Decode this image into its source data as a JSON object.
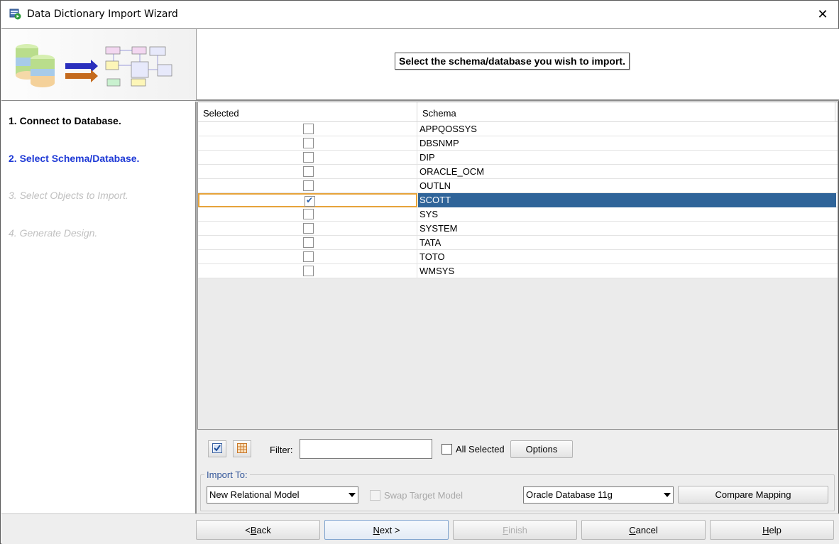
{
  "window": {
    "title": "Data Dictionary Import Wizard",
    "close_glyph": "✕"
  },
  "banner": {
    "title": "Select the schema/database you wish to import."
  },
  "steps": [
    {
      "label": "1. Connect to Database.",
      "state": "done"
    },
    {
      "label": "2. Select Schema/Database.",
      "state": "current"
    },
    {
      "label": "3. Select Objects to Import.",
      "state": "pending"
    },
    {
      "label": "4. Generate Design.",
      "state": "pending"
    }
  ],
  "grid": {
    "columns": [
      "Selected",
      "Schema"
    ],
    "rows": [
      {
        "schema": "APPQOSSYS",
        "selected": false
      },
      {
        "schema": "DBSNMP",
        "selected": false
      },
      {
        "schema": "DIP",
        "selected": false
      },
      {
        "schema": "ORACLE_OCM",
        "selected": false
      },
      {
        "schema": "OUTLN",
        "selected": false
      },
      {
        "schema": "SCOTT",
        "selected": true
      },
      {
        "schema": "SYS",
        "selected": false
      },
      {
        "schema": "SYSTEM",
        "selected": false
      },
      {
        "schema": "TATA",
        "selected": false
      },
      {
        "schema": "TOTO",
        "selected": false
      },
      {
        "schema": "WMSYS",
        "selected": false
      }
    ],
    "highlighted_row": "SCOTT"
  },
  "filter": {
    "label": "Filter:",
    "value": "",
    "all_selected_label": "All Selected",
    "all_selected": false,
    "options_label": "Options",
    "select_all_icon": "check-all-icon",
    "deselect_icon": "table-grid-icon"
  },
  "import_to": {
    "legend": "Import To:",
    "model_value": "New Relational Model",
    "swap_label": "Swap Target Model",
    "db_value": "Oracle Database 11g",
    "compare_label": "Compare Mapping"
  },
  "footer": {
    "back": {
      "prefix": "< ",
      "mnemonic": "B",
      "rest": "ack"
    },
    "next": {
      "mnemonic": "N",
      "rest": "ext >"
    },
    "finish": {
      "mnemonic": "F",
      "rest": "inish"
    },
    "cancel": {
      "mnemonic": "C",
      "rest": "ancel"
    },
    "help": {
      "mnemonic": "H",
      "rest": "elp"
    }
  },
  "colors": {
    "selection_blue": "#2f6499",
    "current_step_blue": "#1f3ad6",
    "pending_gray": "#c0c0c0",
    "focus_orange": "#e6a33a"
  }
}
